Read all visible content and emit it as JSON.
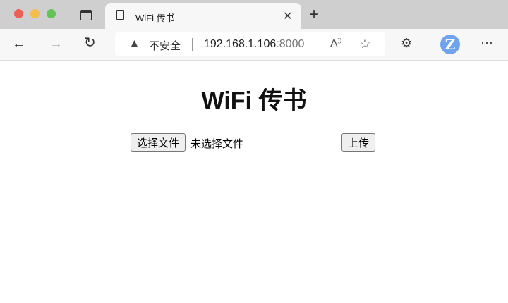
{
  "browser": {
    "tab_title": "WiFi 传书",
    "security_label": "不安全",
    "url_host": "192.168.1.106",
    "url_port": ":8000"
  },
  "page": {
    "heading": "WiFi 传书",
    "choose_file_label": "选择文件",
    "no_file_text": "未选择文件",
    "upload_label": "上传"
  }
}
